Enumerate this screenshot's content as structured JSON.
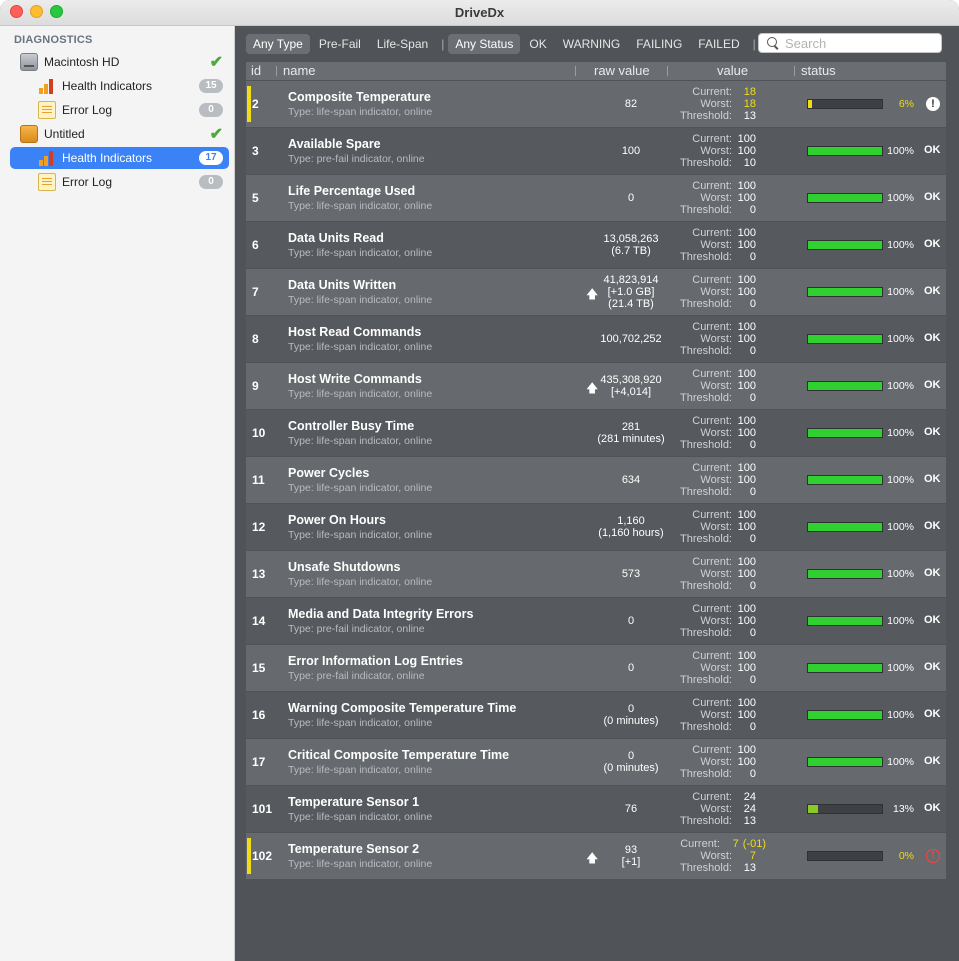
{
  "window": {
    "title": "DriveDx"
  },
  "sidebar": {
    "header": "DIAGNOSTICS",
    "items": [
      {
        "label": "Macintosh HD",
        "icon": "internal-disk-icon",
        "status": "✔",
        "level": 1
      },
      {
        "label": "Health Indicators",
        "icon": "health-bars-icon",
        "badge": "15",
        "level": 2
      },
      {
        "label": "Error Log",
        "icon": "log-icon",
        "badge": "0",
        "level": 2
      },
      {
        "label": "Untitled",
        "icon": "external-disk-icon",
        "status": "✔",
        "level": 1
      },
      {
        "label": "Health Indicators",
        "icon": "health-bars-icon",
        "badge": "17",
        "level": 2,
        "selected": true
      },
      {
        "label": "Error Log",
        "icon": "log-icon",
        "badge": "0",
        "level": 2
      }
    ]
  },
  "filters": {
    "type": [
      "Any Type",
      "Pre-Fail",
      "Life-Span"
    ],
    "status": [
      "Any Status",
      "OK",
      "WARNING",
      "FAILING",
      "FAILED"
    ],
    "search_placeholder": "Search"
  },
  "table": {
    "columns": {
      "id": "id",
      "name": "name",
      "raw": "raw value",
      "value": "value",
      "status": "status"
    },
    "value_labels": {
      "current": "Current:",
      "worst": "Worst:",
      "threshold": "Threshold:"
    },
    "colors": {
      "warning": "#f1dd14",
      "ok": "#2fd02f",
      "low": "#8ac926",
      "failed": "#ff4040"
    },
    "rows": [
      {
        "id": "2",
        "name": "Composite Temperature",
        "type": "Type: life-span indicator, online",
        "raw": [
          "82"
        ],
        "arrow": false,
        "current": "18",
        "worst": "18",
        "threshold": "13",
        "current_extra": "",
        "pct": 6,
        "pct_label": "6%",
        "state": "warning",
        "status": "!"
      },
      {
        "id": "3",
        "name": "Available Spare",
        "type": "Type: pre-fail indicator, online",
        "raw": [
          "100"
        ],
        "arrow": false,
        "current": "100",
        "worst": "100",
        "threshold": "10",
        "current_extra": "",
        "pct": 100,
        "pct_label": "100%",
        "state": "ok",
        "status": "OK"
      },
      {
        "id": "5",
        "name": "Life Percentage Used",
        "type": "Type: life-span indicator, online",
        "raw": [
          "0"
        ],
        "arrow": false,
        "current": "100",
        "worst": "100",
        "threshold": "0",
        "current_extra": "",
        "pct": 100,
        "pct_label": "100%",
        "state": "ok",
        "status": "OK"
      },
      {
        "id": "6",
        "name": "Data Units Read",
        "type": "Type: life-span indicator, online",
        "raw": [
          "13,058,263",
          "(6.7 TB)"
        ],
        "arrow": false,
        "current": "100",
        "worst": "100",
        "threshold": "0",
        "current_extra": "",
        "pct": 100,
        "pct_label": "100%",
        "state": "ok",
        "status": "OK"
      },
      {
        "id": "7",
        "name": "Data Units Written",
        "type": "Type: life-span indicator, online",
        "raw": [
          "41,823,914",
          "[+1.0 GB]",
          "(21.4 TB)"
        ],
        "arrow": true,
        "current": "100",
        "worst": "100",
        "threshold": "0",
        "current_extra": "",
        "pct": 100,
        "pct_label": "100%",
        "state": "ok",
        "status": "OK"
      },
      {
        "id": "8",
        "name": "Host Read Commands",
        "type": "Type: life-span indicator, online",
        "raw": [
          "100,702,252"
        ],
        "arrow": false,
        "current": "100",
        "worst": "100",
        "threshold": "0",
        "current_extra": "",
        "pct": 100,
        "pct_label": "100%",
        "state": "ok",
        "status": "OK"
      },
      {
        "id": "9",
        "name": "Host Write Commands",
        "type": "Type: life-span indicator, online",
        "raw": [
          "435,308,920",
          "[+4,014]"
        ],
        "arrow": true,
        "current": "100",
        "worst": "100",
        "threshold": "0",
        "current_extra": "",
        "pct": 100,
        "pct_label": "100%",
        "state": "ok",
        "status": "OK"
      },
      {
        "id": "10",
        "name": "Controller Busy Time",
        "type": "Type: life-span indicator, online",
        "raw": [
          "281",
          "(281 minutes)"
        ],
        "arrow": false,
        "current": "100",
        "worst": "100",
        "threshold": "0",
        "current_extra": "",
        "pct": 100,
        "pct_label": "100%",
        "state": "ok",
        "status": "OK"
      },
      {
        "id": "11",
        "name": "Power Cycles",
        "type": "Type: life-span indicator, online",
        "raw": [
          "634"
        ],
        "arrow": false,
        "current": "100",
        "worst": "100",
        "threshold": "0",
        "current_extra": "",
        "pct": 100,
        "pct_label": "100%",
        "state": "ok",
        "status": "OK"
      },
      {
        "id": "12",
        "name": "Power On Hours",
        "type": "Type: life-span indicator, online",
        "raw": [
          "1,160",
          "(1,160 hours)"
        ],
        "arrow": false,
        "current": "100",
        "worst": "100",
        "threshold": "0",
        "current_extra": "",
        "pct": 100,
        "pct_label": "100%",
        "state": "ok",
        "status": "OK"
      },
      {
        "id": "13",
        "name": "Unsafe Shutdowns",
        "type": "Type: life-span indicator, online",
        "raw": [
          "573"
        ],
        "arrow": false,
        "current": "100",
        "worst": "100",
        "threshold": "0",
        "current_extra": "",
        "pct": 100,
        "pct_label": "100%",
        "state": "ok",
        "status": "OK"
      },
      {
        "id": "14",
        "name": "Media and Data Integrity Errors",
        "type": "Type: pre-fail indicator, online",
        "raw": [
          "0"
        ],
        "arrow": false,
        "current": "100",
        "worst": "100",
        "threshold": "0",
        "current_extra": "",
        "pct": 100,
        "pct_label": "100%",
        "state": "ok",
        "status": "OK"
      },
      {
        "id": "15",
        "name": "Error Information Log Entries",
        "type": "Type: pre-fail indicator, online",
        "raw": [
          "0"
        ],
        "arrow": false,
        "current": "100",
        "worst": "100",
        "threshold": "0",
        "current_extra": "",
        "pct": 100,
        "pct_label": "100%",
        "state": "ok",
        "status": "OK"
      },
      {
        "id": "16",
        "name": "Warning Composite Temperature Time",
        "type": "Type: life-span indicator, online",
        "raw": [
          "0",
          "(0 minutes)"
        ],
        "arrow": false,
        "current": "100",
        "worst": "100",
        "threshold": "0",
        "current_extra": "",
        "pct": 100,
        "pct_label": "100%",
        "state": "ok",
        "status": "OK"
      },
      {
        "id": "17",
        "name": "Critical Composite Temperature Time",
        "type": "Type: life-span indicator, online",
        "raw": [
          "0",
          "(0 minutes)"
        ],
        "arrow": false,
        "current": "100",
        "worst": "100",
        "threshold": "0",
        "current_extra": "",
        "pct": 100,
        "pct_label": "100%",
        "state": "ok",
        "status": "OK"
      },
      {
        "id": "101",
        "name": "Temperature Sensor 1",
        "type": "Type: life-span indicator, online",
        "raw": [
          "76"
        ],
        "arrow": false,
        "current": "24",
        "worst": "24",
        "threshold": "13",
        "current_extra": "",
        "pct": 13,
        "pct_label": "13%",
        "state": "low",
        "status": "OK"
      },
      {
        "id": "102",
        "name": "Temperature Sensor 2",
        "type": "Type: life-span indicator, online",
        "raw": [
          "93",
          "[+1]"
        ],
        "arrow": true,
        "current": "7",
        "worst": "7",
        "threshold": "13",
        "current_extra": "(-01)",
        "pct": 0,
        "pct_label": "0%",
        "state": "failed",
        "status": "!"
      }
    ]
  }
}
